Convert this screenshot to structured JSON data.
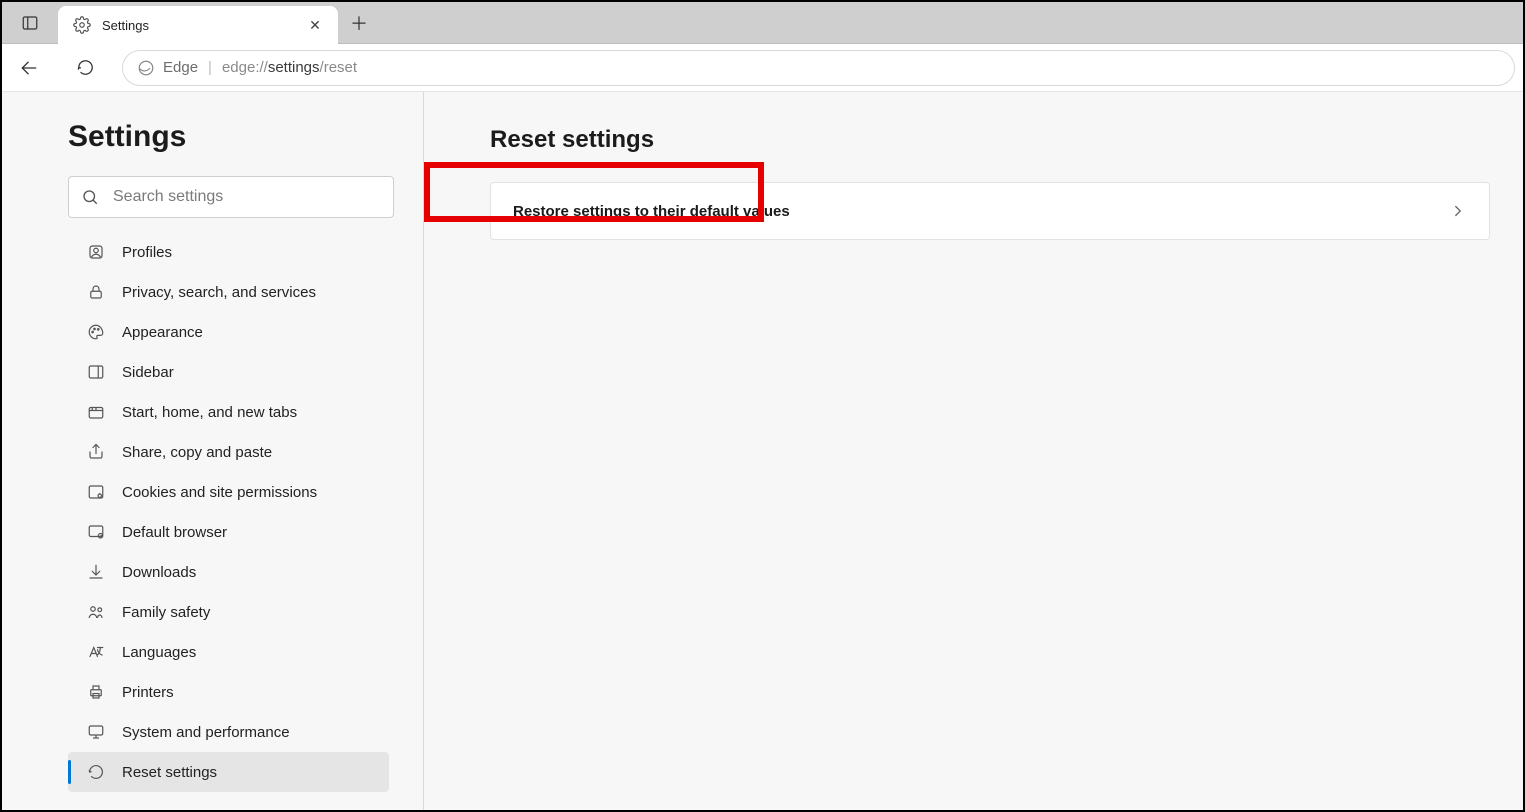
{
  "tab": {
    "title": "Settings"
  },
  "addr": {
    "engine": "Edge",
    "url_prefix": "edge://",
    "url_mid": "settings",
    "url_suffix": "/reset"
  },
  "sidebar": {
    "title": "Settings",
    "search_placeholder": "Search settings",
    "items": [
      {
        "label": "Profiles"
      },
      {
        "label": "Privacy, search, and services"
      },
      {
        "label": "Appearance"
      },
      {
        "label": "Sidebar"
      },
      {
        "label": "Start, home, and new tabs"
      },
      {
        "label": "Share, copy and paste"
      },
      {
        "label": "Cookies and site permissions"
      },
      {
        "label": "Default browser"
      },
      {
        "label": "Downloads"
      },
      {
        "label": "Family safety"
      },
      {
        "label": "Languages"
      },
      {
        "label": "Printers"
      },
      {
        "label": "System and performance"
      },
      {
        "label": "Reset settings"
      }
    ]
  },
  "main": {
    "heading": "Reset settings",
    "card_label": "Restore settings to their default values"
  },
  "colors": {
    "accent": "#0078d4",
    "annotation": "#e60000"
  }
}
